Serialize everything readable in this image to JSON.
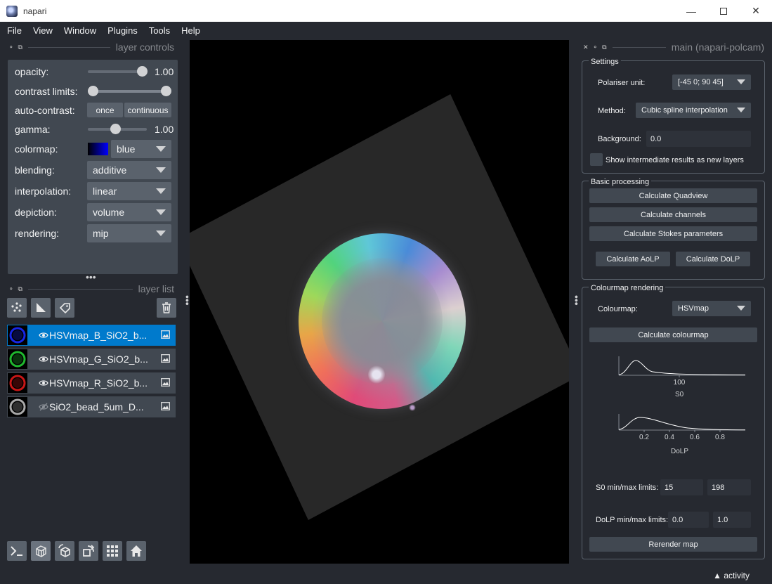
{
  "window": {
    "title": "napari"
  },
  "menu": [
    "File",
    "View",
    "Window",
    "Plugins",
    "Tools",
    "Help"
  ],
  "layer_controls": {
    "title": "layer controls",
    "opacity_label": "opacity:",
    "opacity_value": "1.00",
    "contrast_label": "contrast limits:",
    "autocontrast_label": "auto-contrast:",
    "once_label": "once",
    "continuous_label": "continuous",
    "gamma_label": "gamma:",
    "gamma_value": "1.00",
    "colormap_label": "colormap:",
    "colormap_value": "blue",
    "blending_label": "blending:",
    "blending_value": "additive",
    "interpolation_label": "interpolation:",
    "interpolation_value": "linear",
    "depiction_label": "depiction:",
    "depiction_value": "volume",
    "rendering_label": "rendering:",
    "rendering_value": "mip"
  },
  "layer_list": {
    "title": "layer list",
    "layers": [
      {
        "name": "HSVmap_B_SiO2_b...",
        "color": "#1a2aff",
        "visible": true,
        "selected": true
      },
      {
        "name": "HSVmap_G_SiO2_b...",
        "color": "#22cc33",
        "visible": true,
        "selected": false
      },
      {
        "name": "HSVmap_R_SiO2_b...",
        "color": "#e01818",
        "visible": true,
        "selected": false
      },
      {
        "name": "SiO2_bead_5um_D...",
        "color": "#bbbbbb",
        "visible": false,
        "selected": false
      }
    ]
  },
  "plugin": {
    "title": "main (napari-polcam)",
    "settings": {
      "title": "Settings",
      "polariser_label": "Polariser unit:",
      "polariser_value": "[-45 0; 90 45]",
      "method_label": "Method:",
      "method_value": "Cubic spline interpolation",
      "background_label": "Background:",
      "background_value": "0.0",
      "intermediate_label": "Show intermediate results as new layers"
    },
    "basic": {
      "title": "Basic processing",
      "quadview": "Calculate Quadview",
      "channels": "Calculate channels",
      "stokes": "Calculate Stokes parameters",
      "aolp": "Calculate AoLP",
      "dolp": "Calculate DoLP"
    },
    "colourmap": {
      "title": "Colourmap rendering",
      "colourmap_label": "Colourmap:",
      "colourmap_value": "HSVmap",
      "calc": "Calculate colourmap",
      "s0_tick": "100",
      "s0_label": "S0",
      "dolp_ticks": [
        "0.2",
        "0.4",
        "0.6",
        "0.8"
      ],
      "dolp_label": "DoLP",
      "s0_limits_label": "S0 min/max limits:",
      "s0_min": "15",
      "s0_max": "198",
      "dolp_limits_label": "DoLP min/max limits:",
      "dolp_min": "0.0",
      "dolp_max": "1.0",
      "rerender": "Rerender map"
    }
  },
  "status": {
    "activity": "activity"
  }
}
